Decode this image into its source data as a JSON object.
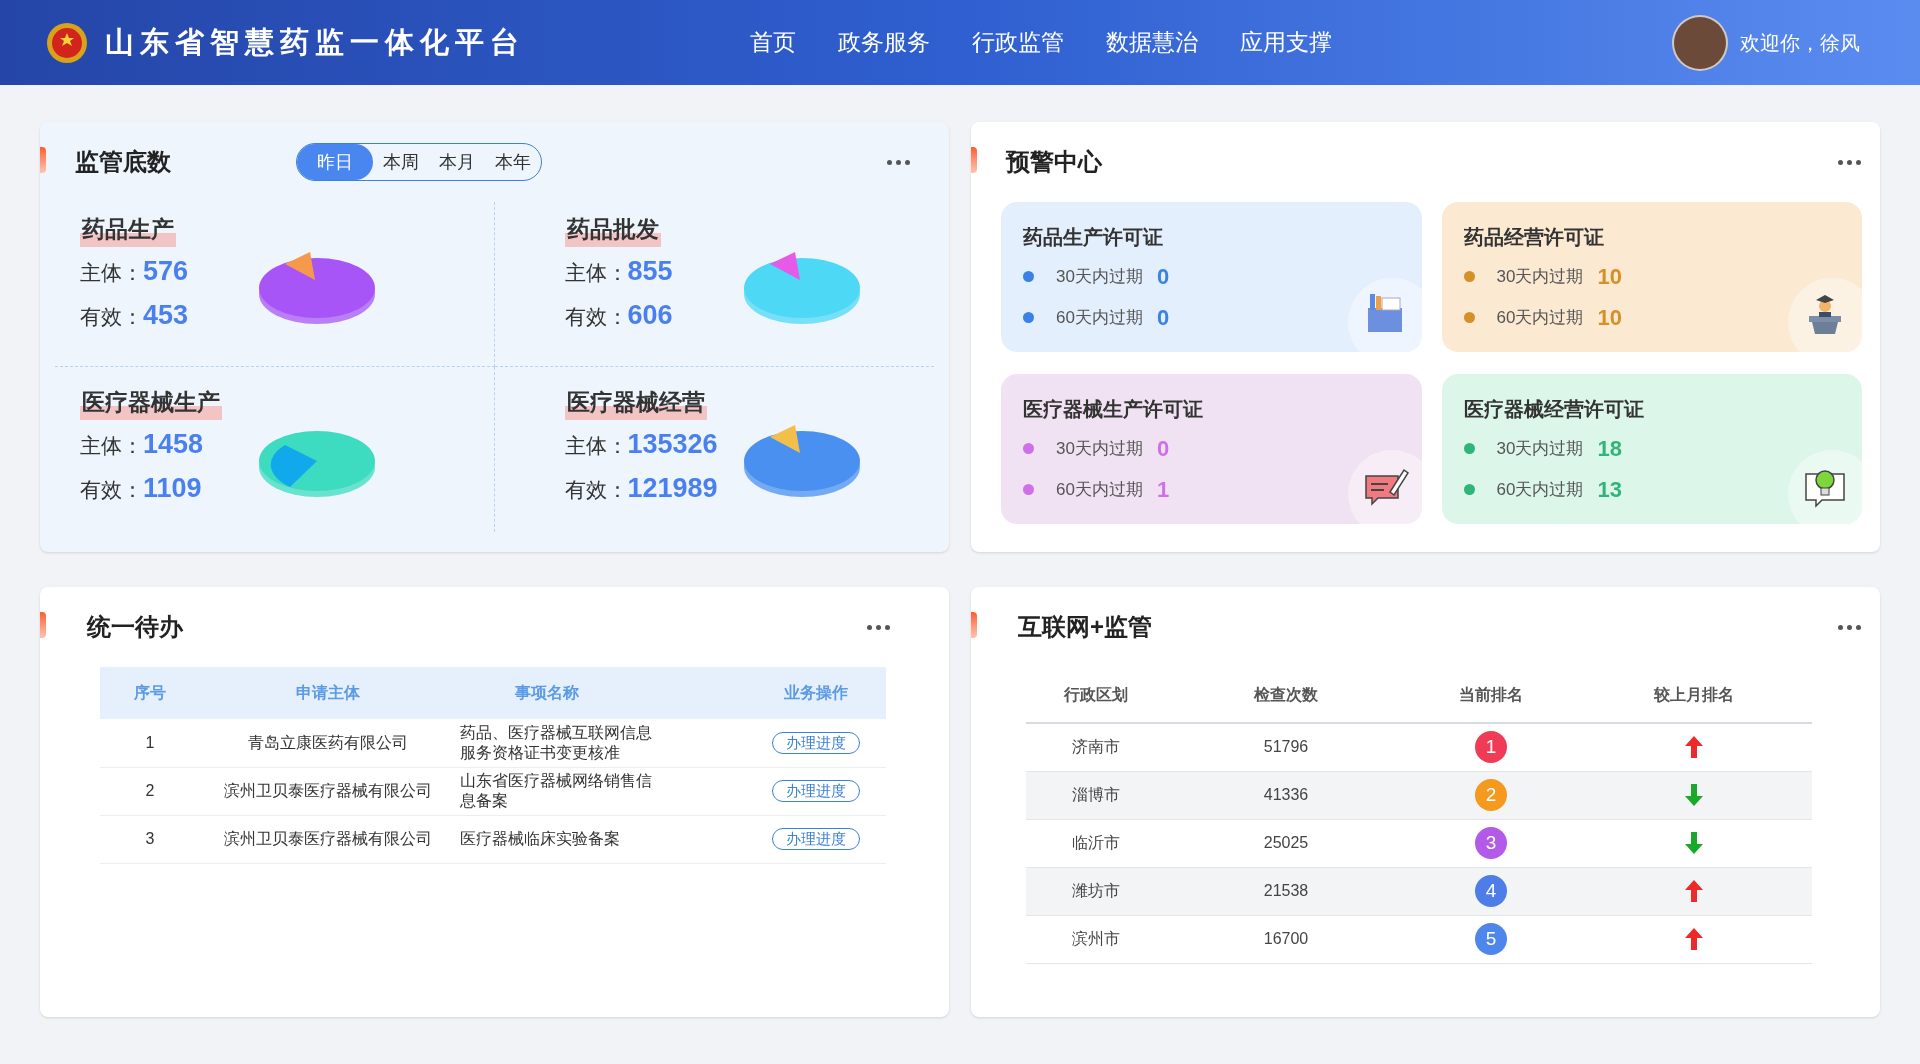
{
  "header": {
    "title": "山东省智慧药监一体化平台",
    "nav": [
      {
        "label": "首页"
      },
      {
        "label": "政务服务"
      },
      {
        "label": "行政监管"
      },
      {
        "label": "数据慧治"
      },
      {
        "label": "应用支撑"
      }
    ],
    "greeting": "欢迎你，徐风"
  },
  "supervision": {
    "title": "监管底数",
    "periods": [
      {
        "label": "昨日",
        "selected": true
      },
      {
        "label": "本周",
        "selected": false
      },
      {
        "label": "本月",
        "selected": false
      },
      {
        "label": "本年",
        "selected": false
      }
    ],
    "stats": [
      {
        "name": "药品生产",
        "subject_label": "主体：",
        "subject": "576",
        "valid_label": "有效：",
        "valid": "453",
        "color": "#a855f7"
      },
      {
        "name": "药品批发",
        "subject_label": "主体：",
        "subject": "855",
        "valid_label": "有效：",
        "valid": "606",
        "color": "#4dd8f5"
      },
      {
        "name": "医疗器械生产",
        "subject_label": "主体：",
        "subject": "1458",
        "valid_label": "有效：",
        "valid": "1109",
        "color": "#3ddbc0"
      },
      {
        "name": "医疗器械经营",
        "subject_label": "主体：",
        "subject": "135326",
        "valid_label": "有效：",
        "valid": "121989",
        "color": "#4a90f0"
      }
    ]
  },
  "alerts": {
    "title": "预警中心",
    "cards": [
      {
        "title": "药品生产许可证",
        "color": "#3b82e6",
        "kind": "folder",
        "rows": [
          {
            "label": "30天内过期",
            "value": "0"
          },
          {
            "label": "60天内过期",
            "value": "0"
          }
        ]
      },
      {
        "title": "药品经营许可证",
        "color": "#d4912a",
        "kind": "lecturer",
        "rows": [
          {
            "label": "30天内过期",
            "value": "10"
          },
          {
            "label": "60天内过期",
            "value": "10"
          }
        ]
      },
      {
        "title": "医疗器械生产许可证",
        "color": "#d070e8",
        "kind": "message",
        "rows": [
          {
            "label": "30天内过期",
            "value": "0"
          },
          {
            "label": "60天内过期",
            "value": "1"
          }
        ]
      },
      {
        "title": "医疗器械经营许可证",
        "color": "#2fb57a",
        "kind": "bulb",
        "rows": [
          {
            "label": "30天内过期",
            "value": "18"
          },
          {
            "label": "60天内过期",
            "value": "13"
          }
        ]
      }
    ]
  },
  "todo": {
    "title": "统一待办",
    "columns": [
      "序号",
      "申请主体",
      "事项名称",
      "业务操作"
    ],
    "rows": [
      {
        "index": "1",
        "applicant": "青岛立康医药有限公司",
        "item": "药品、医疗器械互联网信息服务资格证书变更核准",
        "action": "办理进度"
      },
      {
        "index": "2",
        "applicant": "滨州卫贝泰医疗器械有限公司",
        "item": "山东省医疗器械网络销售信息备案",
        "action": "办理进度"
      },
      {
        "index": "3",
        "applicant": "滨州卫贝泰医疗器械有限公司",
        "item": "医疗器械临床实验备案",
        "action": "办理进度"
      }
    ]
  },
  "internet": {
    "title": "互联网+监管",
    "columns": [
      "行政区划",
      "检查次数",
      "当前排名",
      "较上月排名"
    ],
    "rows": [
      {
        "region": "济南市",
        "count": "51796",
        "rank": "1",
        "color": "#ef3b55",
        "kind": "up"
      },
      {
        "region": "淄博市",
        "count": "41336",
        "rank": "2",
        "color": "#f59a1e",
        "kind": "down"
      },
      {
        "region": "临沂市",
        "count": "25025",
        "rank": "3",
        "color": "#b45ae8",
        "kind": "down"
      },
      {
        "region": "潍坊市",
        "count": "21538",
        "rank": "4",
        "color": "#4f7de8",
        "kind": "up"
      },
      {
        "region": "滨州市",
        "count": "16700",
        "rank": "5",
        "color": "#4f86ec",
        "kind": "up"
      }
    ]
  }
}
